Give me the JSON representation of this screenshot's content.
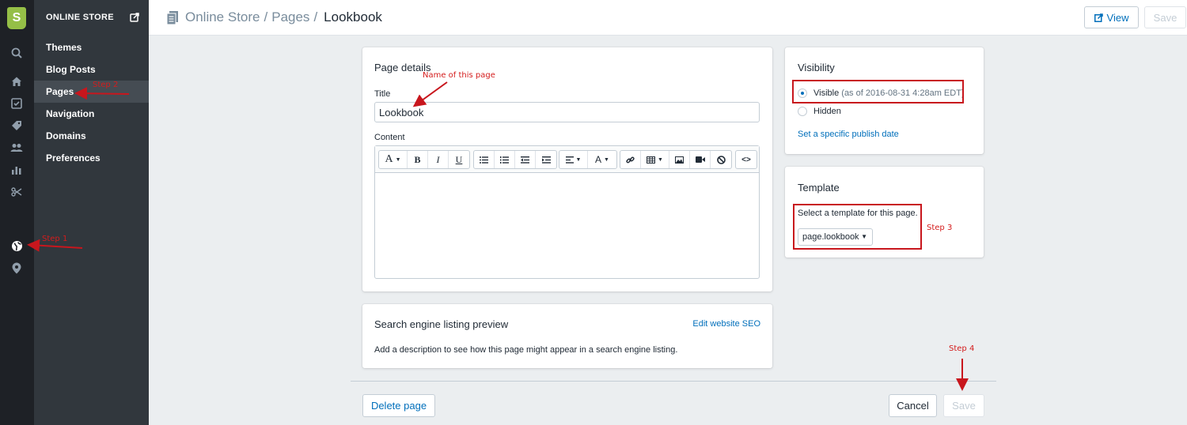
{
  "nav": {
    "section_title": "ONLINE STORE",
    "items": [
      {
        "label": "Themes"
      },
      {
        "label": "Blog Posts"
      },
      {
        "label": "Pages"
      },
      {
        "label": "Navigation"
      },
      {
        "label": "Domains"
      },
      {
        "label": "Preferences"
      }
    ],
    "rail_icons": [
      "shopify-logo",
      "search-icon",
      "home-icon",
      "orders-icon",
      "products-icon",
      "customers-icon",
      "reports-icon",
      "discounts-icon",
      "online-store-icon",
      "location-icon"
    ]
  },
  "header": {
    "breadcrumb_1": "Online Store",
    "breadcrumb_2": "Pages",
    "separator": "/",
    "current": "Lookbook",
    "view_label": "View",
    "save_label": "Save"
  },
  "page_details": {
    "heading": "Page details",
    "title_label": "Title",
    "title_value": "Lookbook",
    "content_label": "Content"
  },
  "visibility": {
    "heading": "Visibility",
    "visible_label": "Visible",
    "visible_note": "(as of 2016-08-31 4:28am EDT)",
    "hidden_label": "Hidden",
    "publish_link": "Set a specific publish date"
  },
  "template": {
    "heading": "Template",
    "description": "Select a template for this page.",
    "selected": "page.lookbook"
  },
  "seo": {
    "heading": "Search engine listing preview",
    "edit_link": "Edit website SEO",
    "description": "Add a description to see how this page might appear in a search engine listing."
  },
  "footer": {
    "delete_label": "Delete page",
    "cancel_label": "Cancel",
    "save_label": "Save"
  },
  "annotations": {
    "step1": "Step 1",
    "step2": "Step 2",
    "step3": "Step 3",
    "step4": "Step 4",
    "name_note": "Name of this page"
  },
  "colors": {
    "accent": "#006fbb",
    "annotation": "#c8161d",
    "rail": "#1e2126",
    "subnav": "#31373d"
  }
}
